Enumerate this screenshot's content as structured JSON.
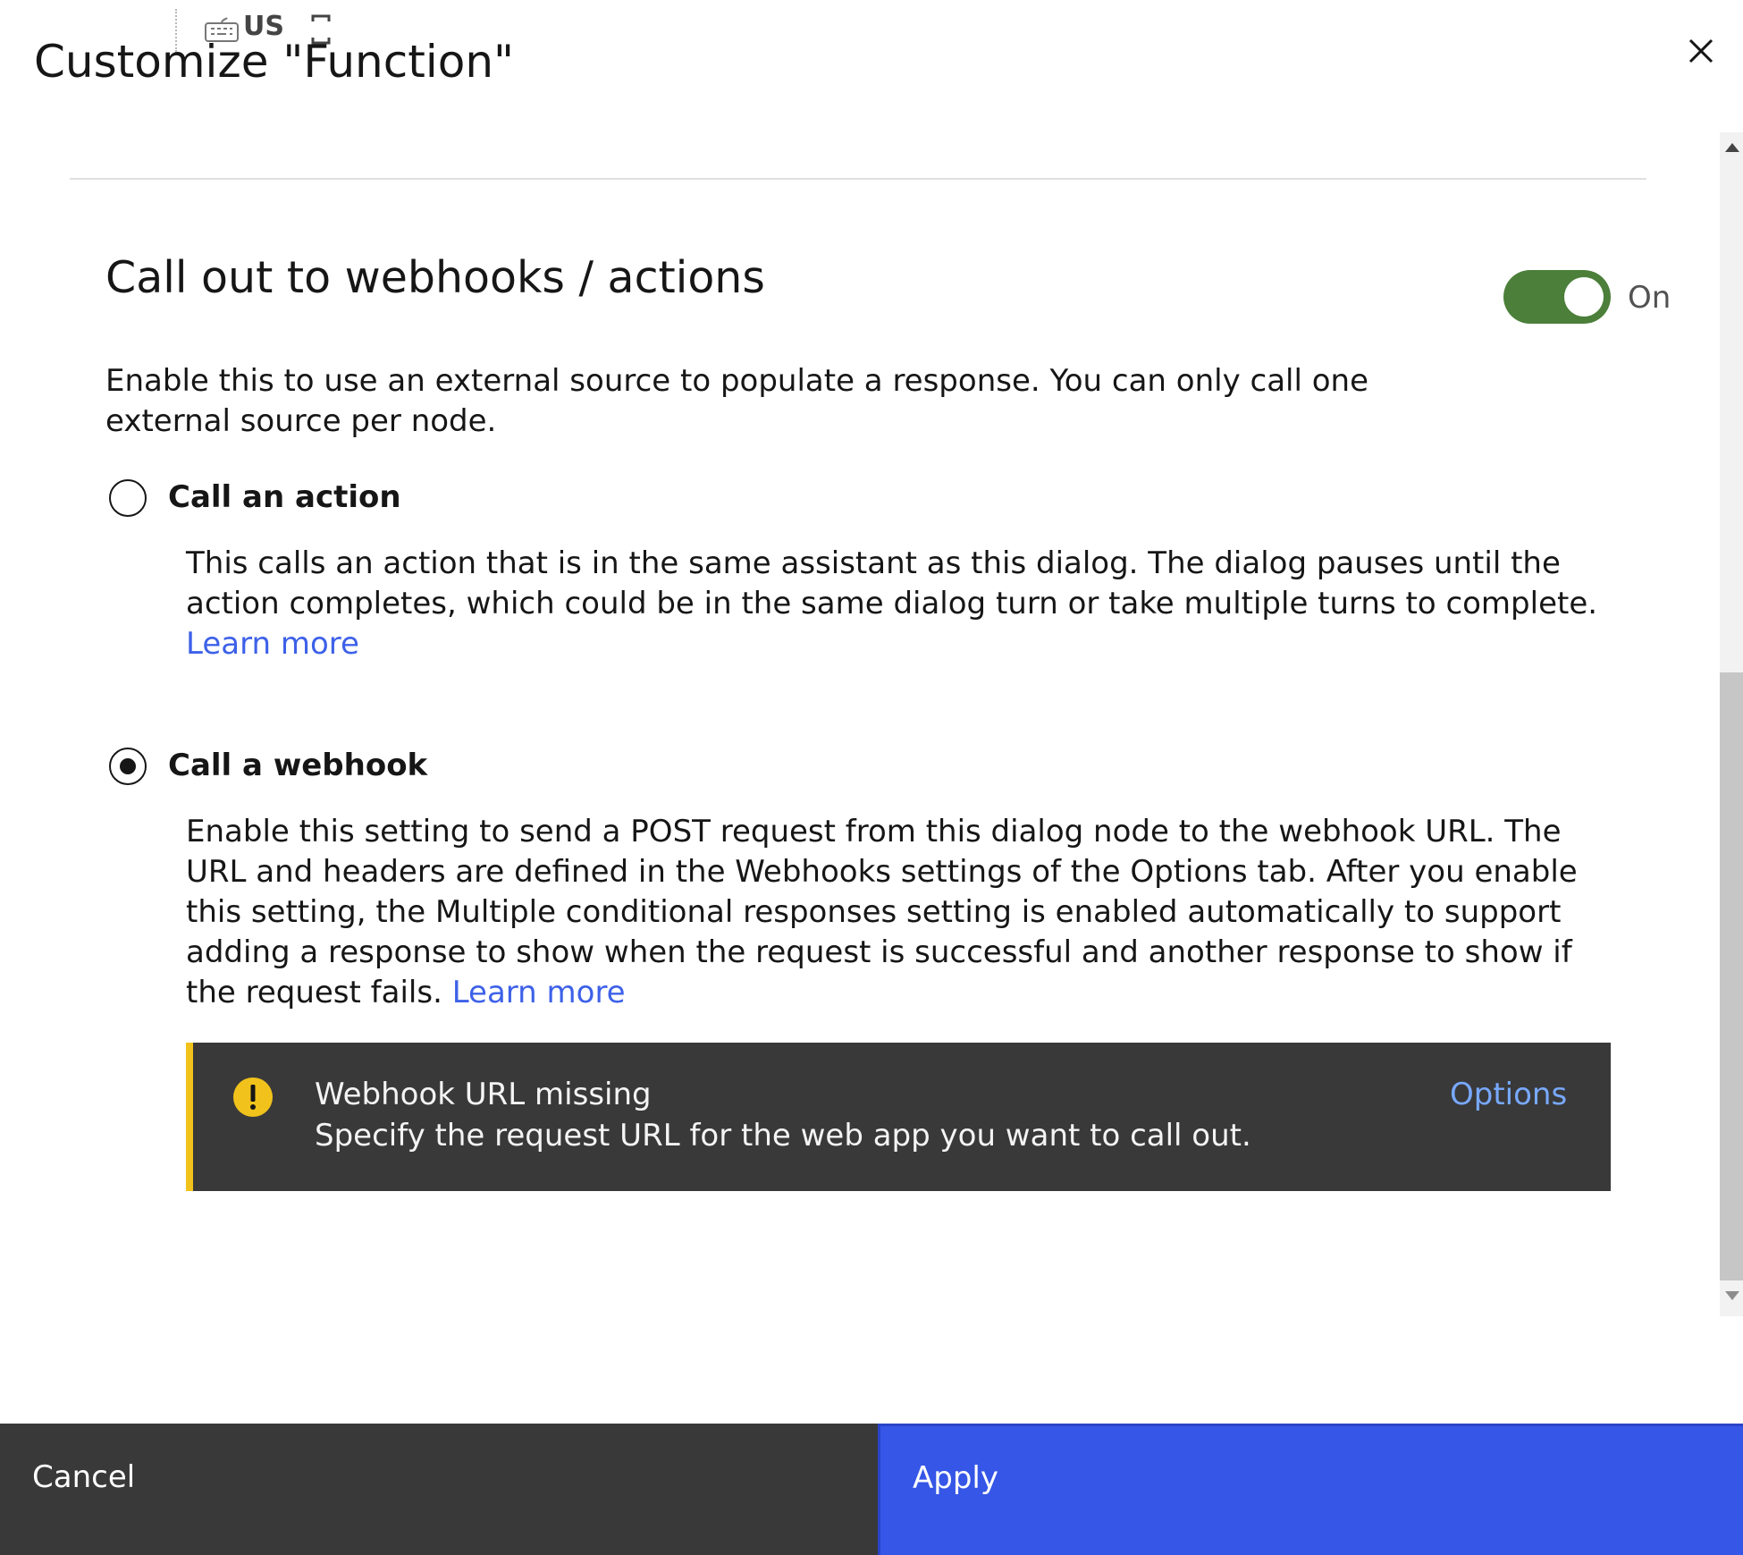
{
  "keyboard_indicator": {
    "layout": "US"
  },
  "dialog": {
    "title": "Customize \"Function\"",
    "close_icon": "close-icon"
  },
  "callout": {
    "heading": "Call out to webhooks / actions",
    "toggle_state": "On",
    "description": "Enable this to use an external source to populate a response. You can only call one external source per node.",
    "options": [
      {
        "label": "Call an action",
        "selected": false,
        "description": "This calls an action that is in the same assistant as this dialog. The dialog pauses until the action completes, which could be in the same dialog turn or take multiple turns to complete.",
        "link": "Learn more"
      },
      {
        "label": "Call a webhook",
        "selected": true,
        "description": "Enable this setting to send a POST request from this dialog node to the webhook URL. The URL and headers are defined in the Webhooks settings of the Options tab. After you enable this setting, the Multiple conditional responses setting is enabled automatically to support adding a response to show when the request is successful and another response to show if the request fails.",
        "link": "Learn more"
      }
    ]
  },
  "notification": {
    "title": "Webhook URL missing",
    "subtitle": "Specify the request URL for the web app you want to call out.",
    "action": "Options",
    "icon": "warning-icon"
  },
  "footer": {
    "cancel_label": "Cancel",
    "apply_label": "Apply"
  },
  "colors": {
    "toggle_on": "#4b7f3a",
    "link": "#3d61e8",
    "primary_button": "#3556e6",
    "secondary_button": "#393939",
    "warning": "#f1c21b",
    "notification_bg": "#393939"
  }
}
